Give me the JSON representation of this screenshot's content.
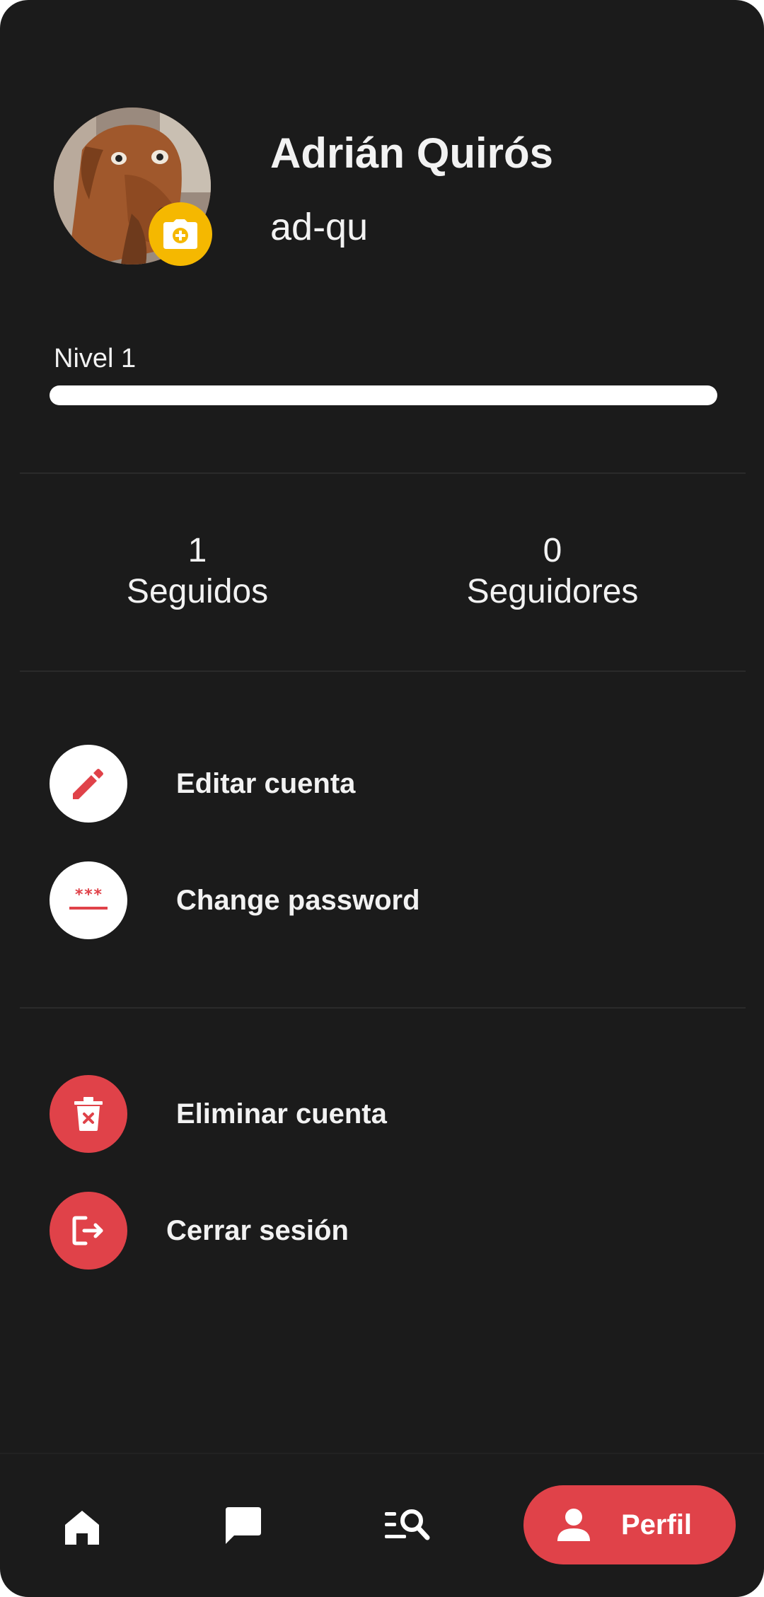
{
  "profile": {
    "name": "Adrián Quirós",
    "handle": "ad-qu"
  },
  "level": {
    "label": "Nivel 1",
    "progress": 1.0
  },
  "stats": {
    "following_count": "1",
    "following_label": "Seguidos",
    "followers_count": "0",
    "followers_label": "Seguidores"
  },
  "menu": {
    "edit_account": "Editar cuenta",
    "change_password": "Change password",
    "delete_account": "Eliminar cuenta",
    "logout": "Cerrar sesión"
  },
  "nav": {
    "active_label": "Perfil",
    "items": [
      "home-icon",
      "chat-icon",
      "search-list-icon",
      "person-icon"
    ]
  },
  "colors": {
    "background": "#1b1b1b",
    "accent_red": "#e04249",
    "badge_yellow": "#f5b800"
  }
}
